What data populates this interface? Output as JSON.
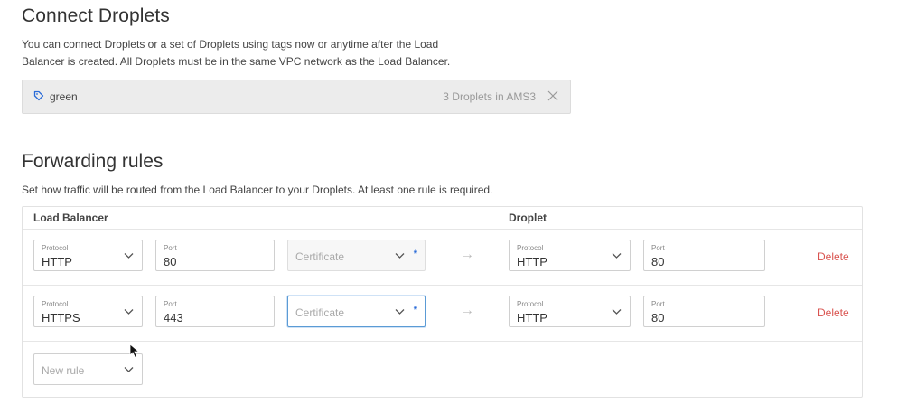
{
  "connect": {
    "title": "Connect Droplets",
    "desc_line1": "You can connect Droplets or a set of Droplets using tags now or anytime after the Load",
    "desc_line2": "Balancer is created. All Droplets must be in the same VPC network as the Load Balancer.",
    "tag": {
      "name": "green",
      "count": "3 Droplets in AMS3"
    }
  },
  "forwarding": {
    "title": "Forwarding rules",
    "desc": "Set how traffic will be routed from the Load Balancer to your Droplets. At least one rule is required.",
    "header_lb": "Load Balancer",
    "header_droplet": "Droplet",
    "rows": [
      {
        "lb_protocol_label": "Protocol",
        "lb_protocol": "HTTP",
        "lb_port_label": "Port",
        "lb_port": "80",
        "certificate_placeholder": "Certificate",
        "droplet_protocol_label": "Protocol",
        "droplet_protocol": "HTTP",
        "droplet_port_label": "Port",
        "droplet_port": "80",
        "delete": "Delete"
      },
      {
        "lb_protocol_label": "Protocol",
        "lb_protocol": "HTTPS",
        "lb_port_label": "Port",
        "lb_port": "443",
        "certificate_placeholder": "Certificate",
        "droplet_protocol_label": "Protocol",
        "droplet_protocol": "HTTP",
        "droplet_port_label": "Port",
        "droplet_port": "80",
        "delete": "Delete"
      }
    ],
    "new_rule_placeholder": "New rule",
    "required_mark": "*",
    "arrow": "→"
  },
  "colors": {
    "delete": "#d9534f",
    "required": "#2a6bd8",
    "focus": "#5b9bd5"
  }
}
